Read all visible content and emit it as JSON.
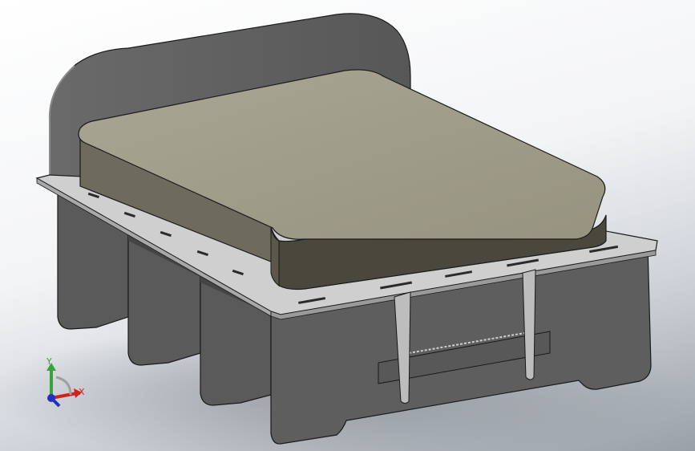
{
  "viewport": {
    "background_top": "#ffffff",
    "background_bottom": "#9aa0a8"
  },
  "model": {
    "body_color": "#5c5c5c",
    "body_dark": "#4b4b4b",
    "plate_color": "#c9c9c9",
    "mattress_top": "#a19e8d",
    "mattress_side": "#6e6b5c",
    "mattress_front": "#4a473d",
    "edge_color": "#1a1a1a"
  },
  "triad": {
    "y_label": "Y",
    "x_label": "X",
    "y_color": "#3aa23a",
    "x_color": "#d02020",
    "z_color": "#2030c0"
  }
}
